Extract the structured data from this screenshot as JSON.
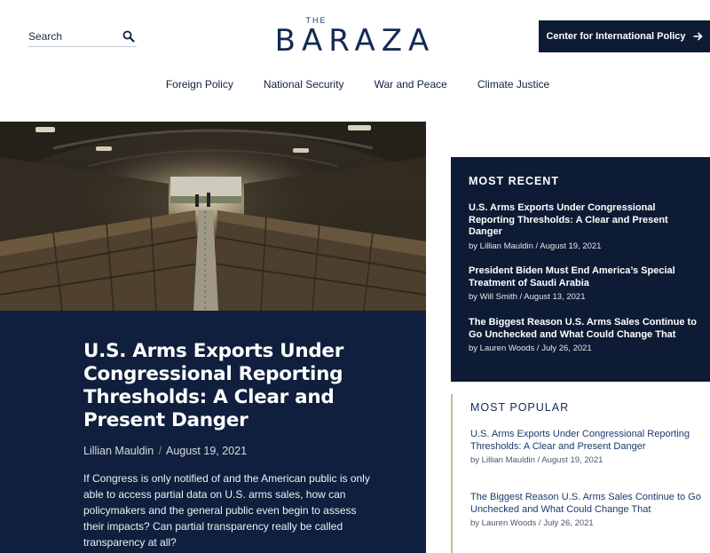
{
  "header": {
    "search_placeholder": "Search",
    "logo_small": "THE",
    "logo_name": "BARAZA",
    "cta_label": "Center for International Policy",
    "cta_icon": "arrow-right-icon"
  },
  "nav": {
    "items": [
      {
        "label": "Foreign Policy"
      },
      {
        "label": "National Security"
      },
      {
        "label": "War and Peace"
      },
      {
        "label": "Climate Justice"
      }
    ]
  },
  "hero": {
    "title": "U.S. Arms Exports Under Congressional Reporting Thresholds: A Clear and Present Danger",
    "author": "Lillian Mauldin",
    "separator": "/",
    "date": "August 19, 2021",
    "description": "If Congress is only notified of and the American public is only able to access partial data on U.S. arms sales, how can policymakers and the general public even begin to assess their impacts? Can partial transparency really be called transparency at all?"
  },
  "most_recent": {
    "heading": "MOST RECENT",
    "items": [
      {
        "title": "U.S. Arms Exports Under Congressional Reporting Thresholds: A Clear and Present Danger",
        "meta": "by Lillian Mauldin / August 19, 2021"
      },
      {
        "title": "President Biden Must End America’s Special Treatment of Saudi Arabia",
        "meta": "by Will Smith / August 13, 2021"
      },
      {
        "title": "The Biggest Reason U.S. Arms Sales Continue to Go Unchecked and What Could Change That",
        "meta": "by Lauren Woods / July 26, 2021"
      }
    ]
  },
  "most_popular": {
    "heading": "MOST POPULAR",
    "items": [
      {
        "title": "U.S. Arms Exports Under Congressional Reporting Thresholds: A Clear and Present Danger",
        "meta": "by Lillian Mauldin / August 19, 2021"
      },
      {
        "title": "The Biggest Reason U.S. Arms Sales Continue to Go Unchecked and What Could Change That",
        "meta": "by Lauren Woods / July 26, 2021"
      }
    ]
  },
  "colors": {
    "navy": "#0f1f3d",
    "dark_navy": "#0e1b34",
    "accent_green": "#b6c58a"
  }
}
